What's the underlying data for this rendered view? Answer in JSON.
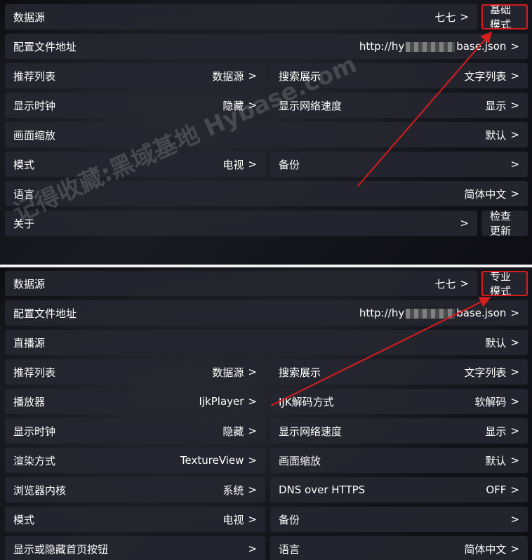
{
  "top_panel": {
    "row_data_source": {
      "label": "数据源",
      "value": "七七"
    },
    "mode_button": {
      "label": "基础模式"
    },
    "row_config": {
      "label": "配置文件地址",
      "url_start": "http://hy",
      "url_end": "base.json"
    },
    "row_recommend": {
      "label": "推荐列表",
      "value": "数据源"
    },
    "row_search": {
      "label": "搜索展示",
      "value": "文字列表"
    },
    "row_clock": {
      "label": "显示时钟",
      "value": "隐藏"
    },
    "row_net_speed": {
      "label": "显示网络速度",
      "value": "显示"
    },
    "row_zoom": {
      "label": "画面缩放",
      "value": "默认"
    },
    "row_mode": {
      "label": "模式",
      "value": "电视"
    },
    "row_backup": {
      "label": "备份"
    },
    "row_language": {
      "label": "语言",
      "value": "简体中文"
    },
    "row_about": {
      "label": "关于"
    },
    "update_button": {
      "label": "检查更新"
    }
  },
  "bottom_panel": {
    "row_data_source": {
      "label": "数据源",
      "value": "七七"
    },
    "mode_button": {
      "label": "专业模式"
    },
    "row_config": {
      "label": "配置文件地址",
      "url_start": "http://hy",
      "url_end": "base.json"
    },
    "row_live": {
      "label": "直播源",
      "value": "默认"
    },
    "row_recommend": {
      "label": "推荐列表",
      "value": "数据源"
    },
    "row_search": {
      "label": "搜索展示",
      "value": "文字列表"
    },
    "row_player": {
      "label": "播放器",
      "value": "IjkPlayer"
    },
    "row_ijk_decode": {
      "label": "IJK解码方式",
      "value": "软解码"
    },
    "row_clock": {
      "label": "显示时钟",
      "value": "隐藏"
    },
    "row_net_speed": {
      "label": "显示网络速度",
      "value": "显示"
    },
    "row_render": {
      "label": "渲染方式",
      "value": "TextureView"
    },
    "row_zoom": {
      "label": "画面缩放",
      "value": "默认"
    },
    "row_browser": {
      "label": "浏览器内核",
      "value": "系统"
    },
    "row_dns": {
      "label": "DNS over HTTPS",
      "value": "OFF"
    },
    "row_mode": {
      "label": "模式",
      "value": "电视"
    },
    "row_backup": {
      "label": "备份"
    },
    "row_home_buttons": {
      "label": "显示或隐藏首页按钮"
    },
    "row_language": {
      "label": "语言",
      "value": "简体中文"
    }
  },
  "chevron": ">",
  "watermark": {
    "text": "记得收藏:黑域基地 Hybase.com"
  },
  "colors": {
    "annotation_red": "#d81d1d",
    "row_bg": "#26262f",
    "text": "#ffffff"
  }
}
